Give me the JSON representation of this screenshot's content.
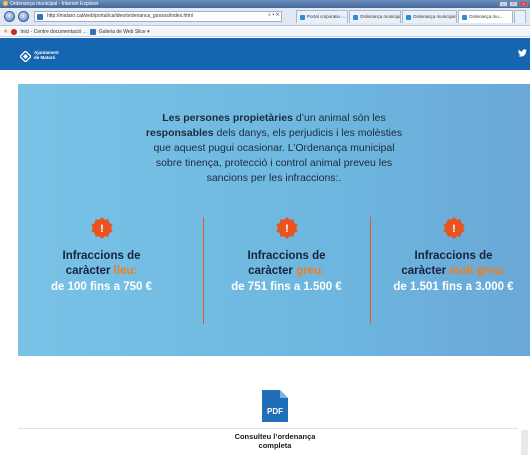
{
  "browser": {
    "window_title": "Ordenança municipal - Internet Explorer",
    "address": "http://mataro.cat/web/portal/ca/ideo/ordenanca_gossos/index.html",
    "tabs": [
      {
        "label": "Portal corporatiu -..."
      },
      {
        "label": "Ordenança municipal"
      },
      {
        "label": "Ordenança municipal"
      },
      {
        "label": "Ordenança mu..."
      }
    ],
    "favorites": [
      {
        "label": "Inici - Centre documentació ..."
      },
      {
        "label": "Galeria de Web Slice ▾"
      }
    ]
  },
  "site": {
    "logo_line1": "Ajuntament",
    "logo_line2": "de Mataró",
    "twitter_glyph": "🐦"
  },
  "banner": {
    "intro_bold_1": "Les persones propietàries",
    "intro_text_1": " d’un animal són les",
    "intro_bold_2": "responsables",
    "intro_text_2": " dels danys, els perjudicis i les molèsties",
    "intro_text_3": "que aquest pugui ocasionar. L’Ordenança municipal",
    "intro_text_4": "sobre tinença, protecció i control animal preveu les",
    "intro_text_5": "sancions per les infraccions:.",
    "columns": [
      {
        "line1": "Infraccions de",
        "line2_prefix": "caràcter ",
        "severity": "lleu:",
        "range": "de 100 fins a 750 €"
      },
      {
        "line1": "Infraccions de",
        "line2_prefix": "caràcter ",
        "severity": "greu:",
        "range": "de 751 fins a 1.500 €"
      },
      {
        "line1": "Infraccions de",
        "line2_prefix": "caràcter ",
        "severity": "molt greu:",
        "range": "de 1.501 fins a 3.000 €"
      }
    ],
    "accent_color": "#f07e1a",
    "warning_glyph": "!"
  },
  "pdf": {
    "icon_label": "PDF",
    "label_line1": "Consulteu l’ordenança",
    "label_line2": "completa"
  }
}
